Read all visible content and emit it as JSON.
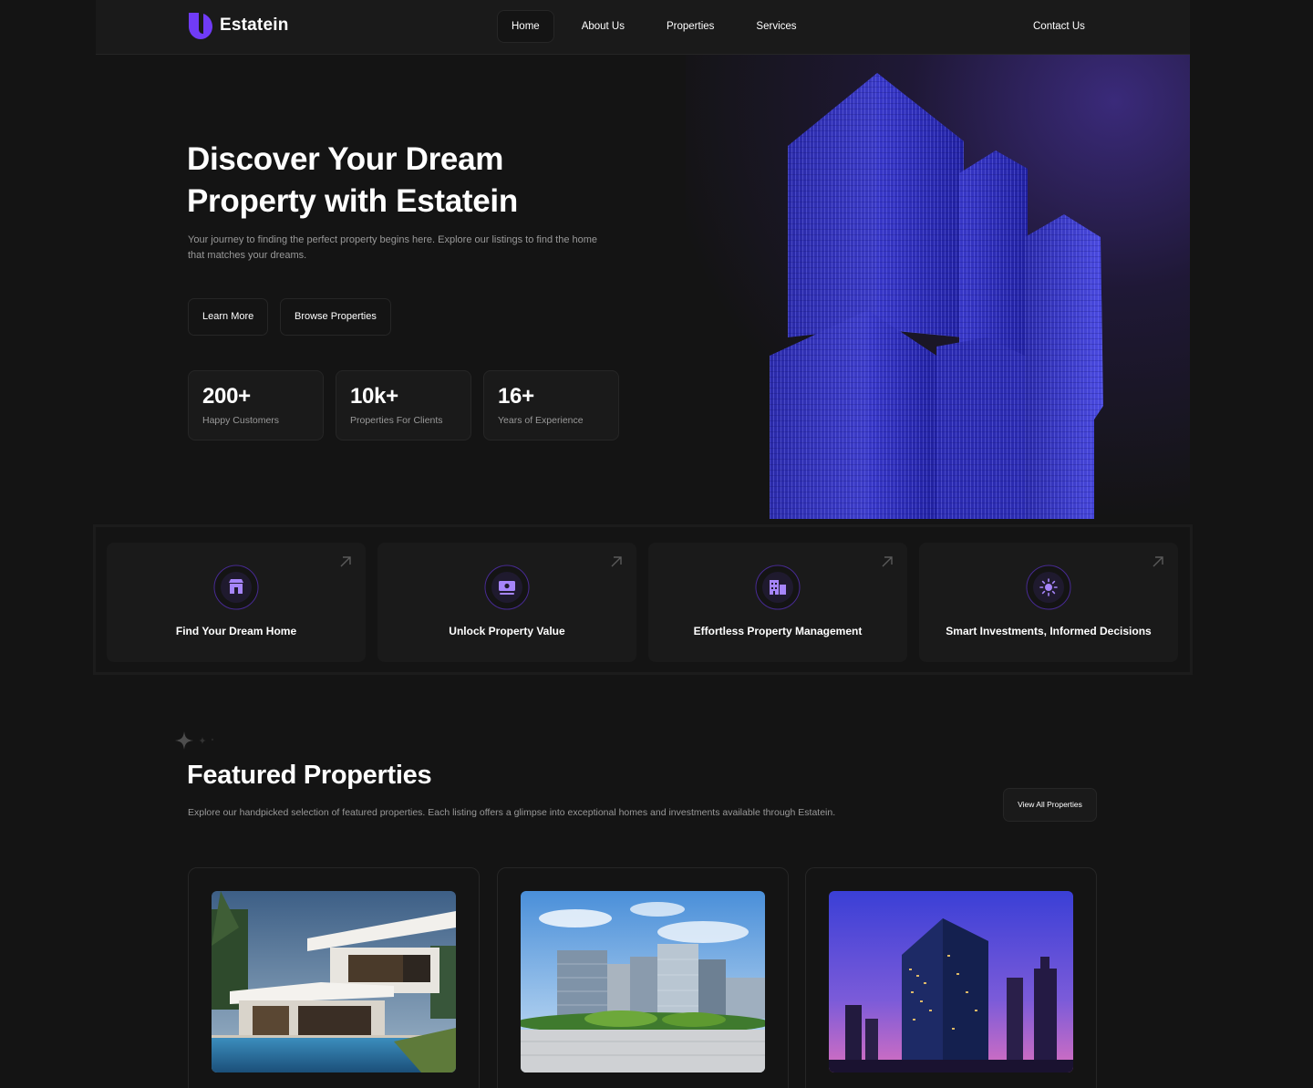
{
  "brand": {
    "name": "Estatein",
    "accent": "#703BF7"
  },
  "nav": {
    "items": [
      {
        "label": "Home",
        "active": true
      },
      {
        "label": "About Us",
        "active": false
      },
      {
        "label": "Properties",
        "active": false
      },
      {
        "label": "Services",
        "active": false
      }
    ],
    "contact_label": "Contact Us"
  },
  "hero": {
    "title": "Discover Your Dream Property with Estatein",
    "description": "Your journey to finding the perfect property begins here. Explore our listings to find the home that matches your dreams.",
    "learn_more_label": "Learn More",
    "browse_label": "Browse Properties",
    "stats": [
      {
        "value": "200+",
        "label": "Happy Customers"
      },
      {
        "value": "10k+",
        "label": "Properties For Clients"
      },
      {
        "value": "16+",
        "label": "Years of Experience"
      }
    ]
  },
  "features": [
    {
      "label": "Find Your Dream Home",
      "icon": "storefront-icon"
    },
    {
      "label": "Unlock Property Value",
      "icon": "cash-icon"
    },
    {
      "label": "Effortless Property Management",
      "icon": "buildings-icon"
    },
    {
      "label": "Smart Investments, Informed Decisions",
      "icon": "sun-icon"
    }
  ],
  "featured": {
    "title": "Featured Properties",
    "description": "Explore our handpicked selection of featured properties. Each listing offers a glimpse into exceptional homes and investments available through Estatein.",
    "view_all_label": "View All Properties",
    "cards": [
      {
        "image": "modern-villa-with-pool"
      },
      {
        "image": "city-office-towers-daylight"
      },
      {
        "image": "skyscrapers-at-dusk"
      }
    ]
  }
}
